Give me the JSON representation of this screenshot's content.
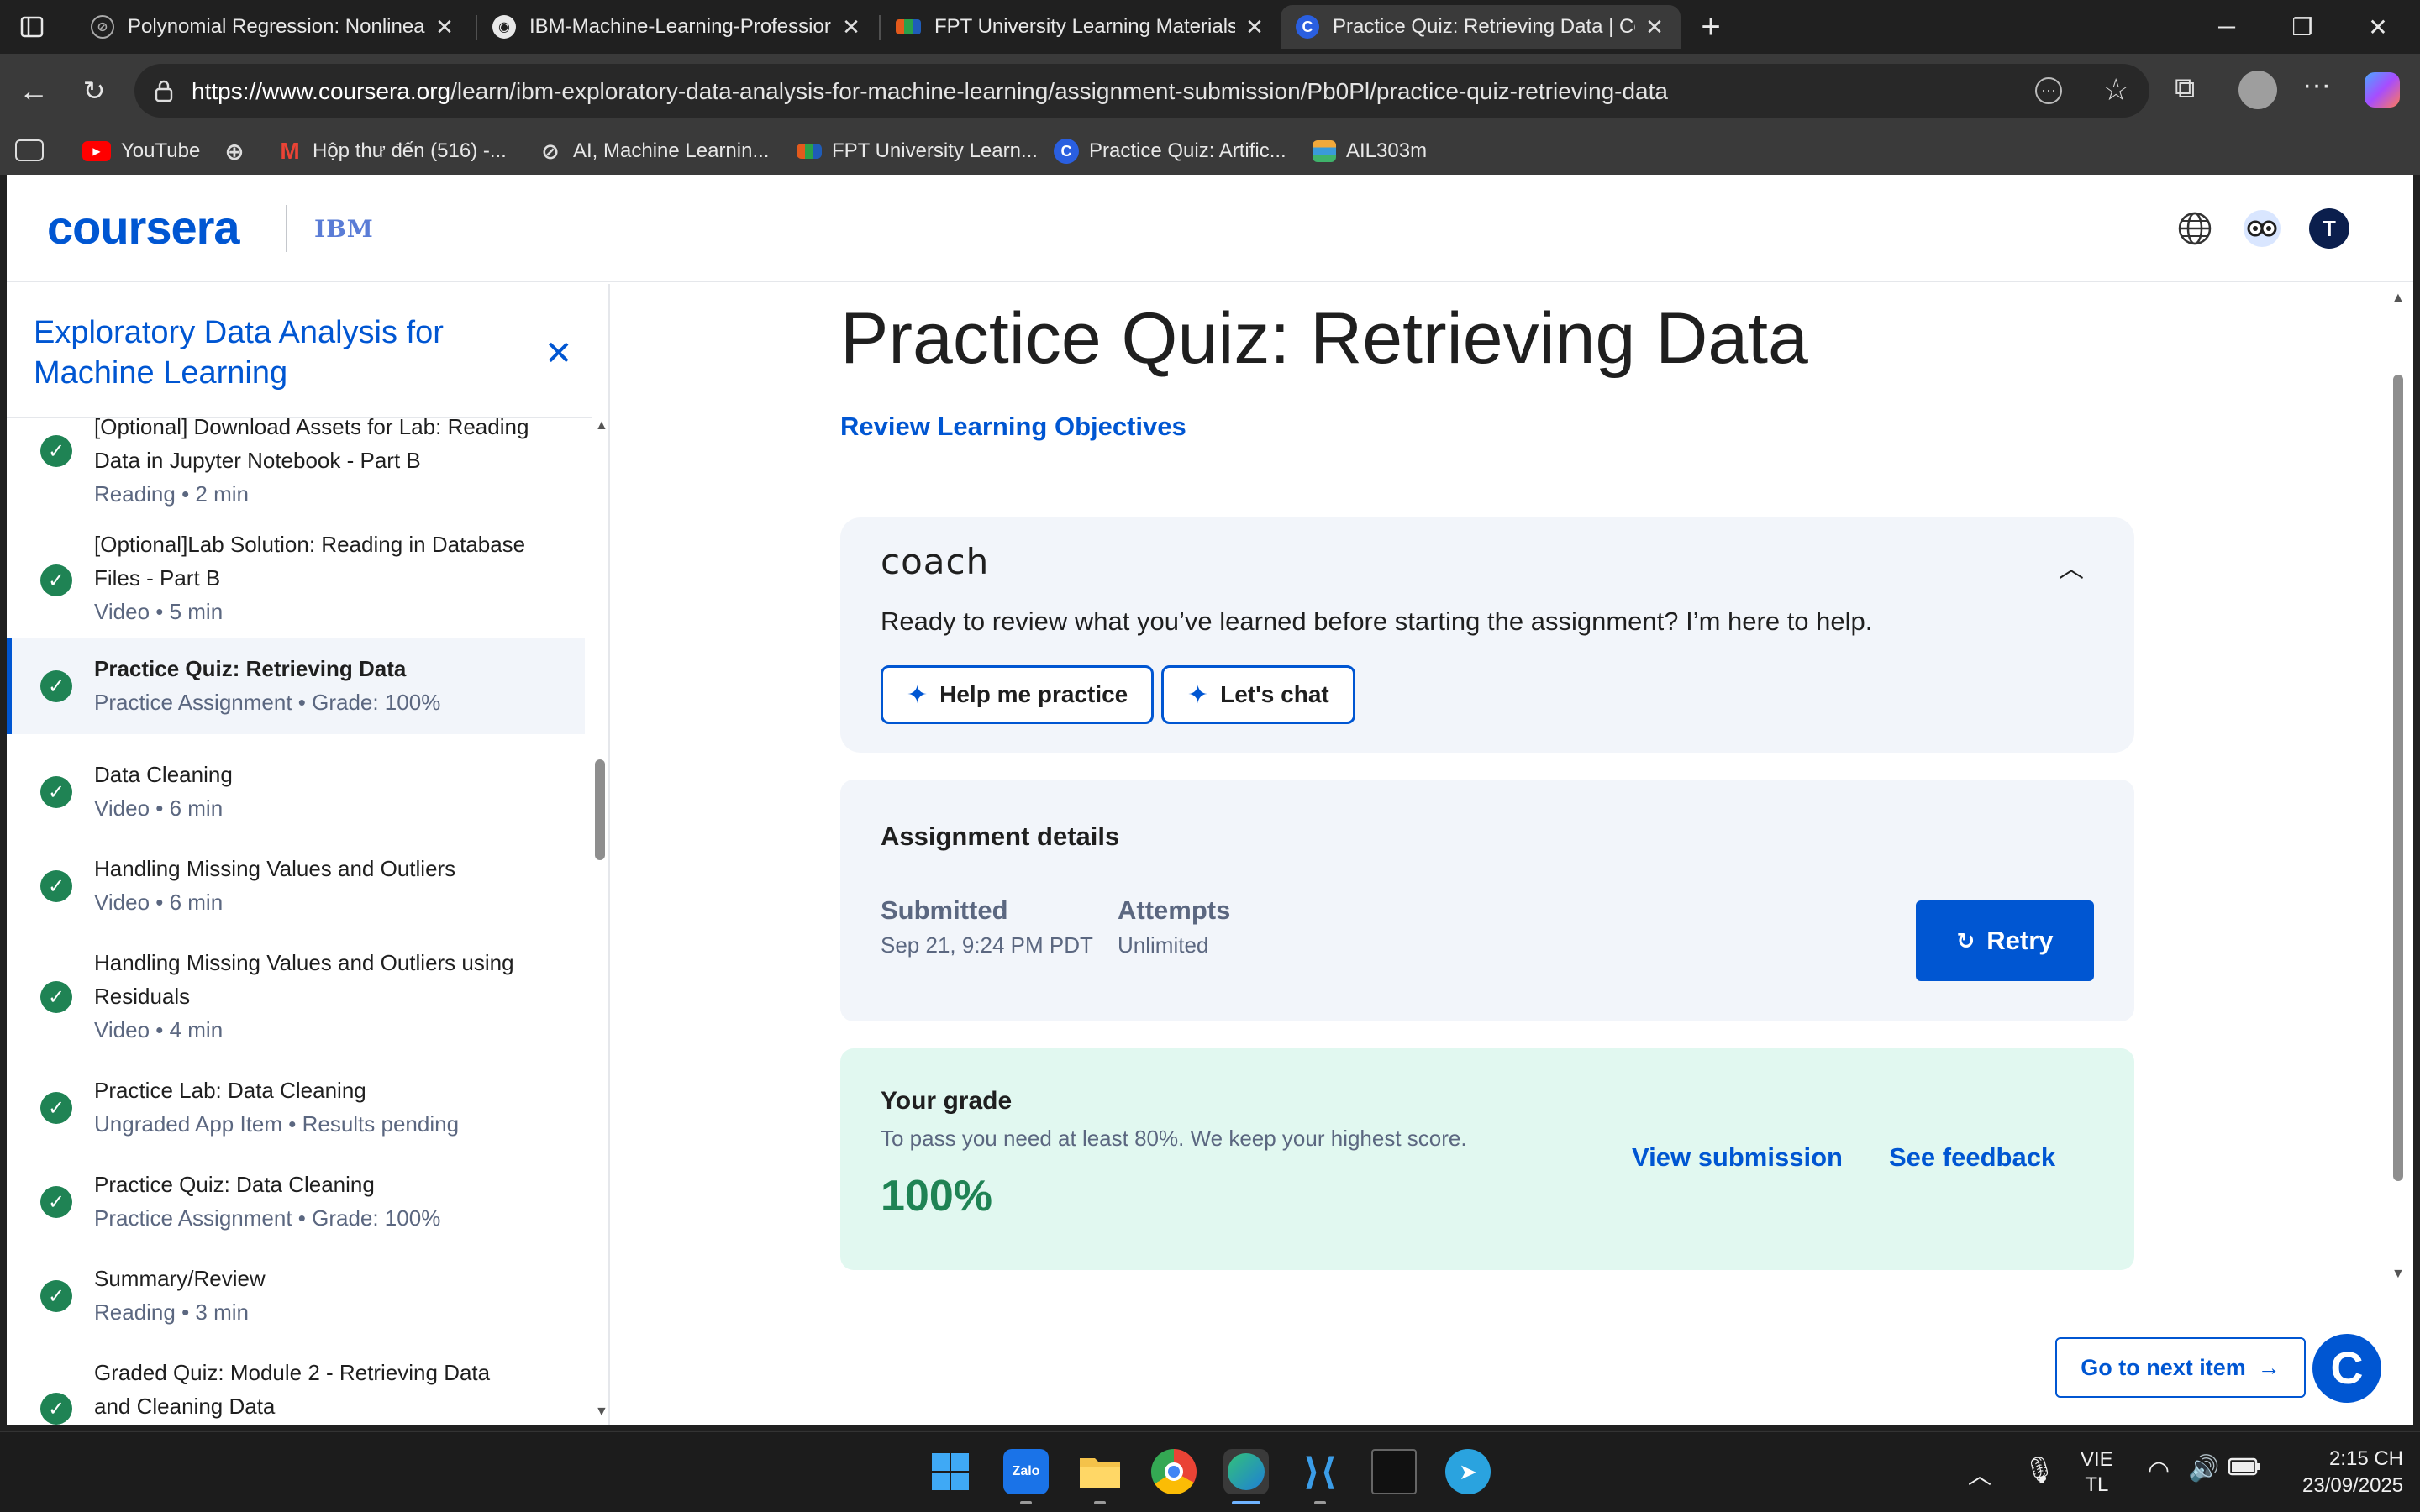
{
  "browser": {
    "tabs": [
      {
        "title": "Polynomial Regression: Nonlinear",
        "icon": "jupyter-icon",
        "active": false
      },
      {
        "title": "IBM-Machine-Learning-Professior",
        "icon": "github-icon",
        "active": false
      },
      {
        "title": "FPT University Learning Materials",
        "icon": "fpt-icon",
        "active": false
      },
      {
        "title": "Practice Quiz: Retrieving Data | Co",
        "icon": "coursera-icon",
        "active": true
      }
    ],
    "url_host": "https://www.coursera.org",
    "url_path": "/learn/ibm-exploratory-data-analysis-for-machine-learning/assignment-submission/Pb0Pl/practice-quiz-retrieving-data",
    "bookmarks": [
      {
        "label": "YouTube",
        "icon": "youtube-icon"
      },
      {
        "label": "",
        "icon": "globe-icon"
      },
      {
        "label": "Hộp thư đến (516) -...",
        "icon": "gmail-icon"
      },
      {
        "label": "AI, Machine Learnin...",
        "icon": "link-icon"
      },
      {
        "label": "FPT University Learn...",
        "icon": "fpt-icon"
      },
      {
        "label": "Practice Quiz: Artific...",
        "icon": "coursera-icon"
      },
      {
        "label": "AIL303m",
        "icon": "stack-icon"
      }
    ]
  },
  "header": {
    "logo": "coursera",
    "partner": "IBM",
    "avatar_initial": "T"
  },
  "sidebar": {
    "course_title": "Exploratory Data Analysis for Machine Learning",
    "items": [
      {
        "title": "[Optional] Download Assets for Lab: Reading Data in Jupyter Notebook - Part B",
        "meta": "Reading • 2 min",
        "completed": true,
        "active": false
      },
      {
        "title": "[Optional]Lab Solution: Reading in Database Files - Part B",
        "meta": "Video • 5 min",
        "completed": true,
        "active": false
      },
      {
        "title": "Practice Quiz: Retrieving Data",
        "meta": "Practice Assignment • Grade: 100%",
        "completed": true,
        "active": true
      },
      {
        "title": "Data Cleaning",
        "meta": "Video • 6 min",
        "completed": true,
        "active": false
      },
      {
        "title": "Handling Missing Values and Outliers",
        "meta": "Video • 6 min",
        "completed": true,
        "active": false
      },
      {
        "title": "Handling Missing Values and Outliers using Residuals",
        "meta": "Video • 4 min",
        "completed": true,
        "active": false
      },
      {
        "title": "Practice Lab: Data Cleaning",
        "meta": "Ungraded App Item • Results pending",
        "completed": true,
        "active": false
      },
      {
        "title": "Practice Quiz: Data Cleaning",
        "meta": "Practice Assignment • Grade: 100%",
        "completed": true,
        "active": false
      },
      {
        "title": "Summary/Review",
        "meta": "Reading • 3 min",
        "completed": true,
        "active": false
      },
      {
        "title": "Graded Quiz: Module 2 - Retrieving Data and Cleaning Data",
        "meta": "",
        "completed": true,
        "active": false
      }
    ]
  },
  "main": {
    "title": "Practice Quiz: Retrieving Data",
    "review_link": "Review Learning Objectives",
    "coach": {
      "logo": "coach",
      "prompt": "Ready to review what you’ve learned before starting the assignment? I’m here to help.",
      "buttons": [
        "Help me practice",
        "Let's chat"
      ]
    },
    "assignment": {
      "title": "Assignment details",
      "submitted_label": "Submitted",
      "submitted_value": "Sep 21, 9:24 PM PDT",
      "attempts_label": "Attempts",
      "attempts_value": "Unlimited",
      "retry_label": "Retry"
    },
    "grade": {
      "title": "Your grade",
      "note": "To pass you need at least 80%. We keep your highest score.",
      "value": "100%",
      "view_submission": "View submission",
      "see_feedback": "See feedback"
    },
    "next_item": "Go to next item"
  },
  "taskbar": {
    "language_line1": "VIE",
    "language_line2": "TL",
    "time": "2:15 CH",
    "date": "23/09/2025"
  },
  "colors": {
    "brand": "#0056d2",
    "success": "#1f8354",
    "grade_bg": "#e1f8f0",
    "card_bg": "#f2f5fa"
  }
}
